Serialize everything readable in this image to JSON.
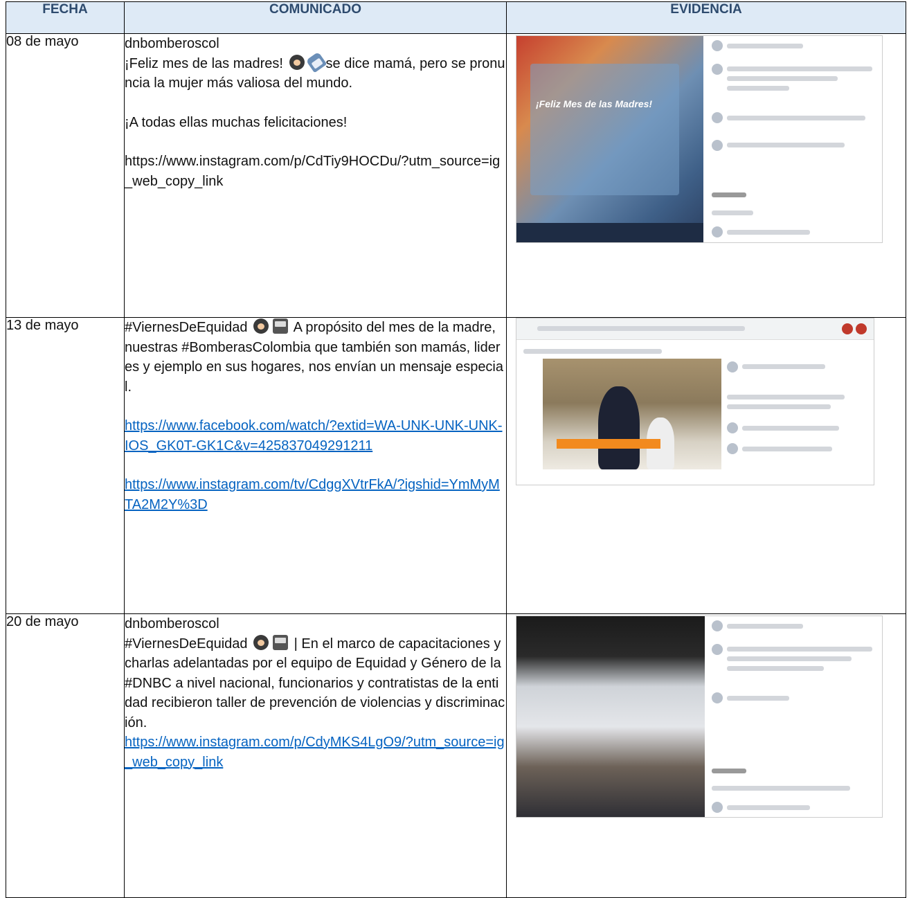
{
  "headers": {
    "fecha": "FECHA",
    "comunicado": "COMUNICADO",
    "evidencia": "EVIDENCIA"
  },
  "rows": [
    {
      "fecha": "08 de mayo",
      "account": "dnbomberoscol",
      "text_a": "¡Feliz mes de las madres!",
      "text_b": "se dice mamá, pero se pronuncia la mujer más valiosa del mundo.",
      "text_c": "¡A todas ellas muchas felicitaciones!",
      "link": "https://www.instagram.com/p/CdTiy9HOCDu/?utm_source=ig_web_copy_link",
      "emoji": [
        "woman-emoji",
        "baby-bottle-emoji"
      ],
      "evidence_banner": "¡Feliz Mes de las Madres!"
    },
    {
      "fecha": "13 de mayo",
      "text_a": "#ViernesDeEquidad",
      "text_b": "A propósito del mes de la madre, nuestras #BomberasColombia que también son mamás, lideres y ejemplo en sus hogares, nos envían un mensaje especial.",
      "link1": "https://www.facebook.com/watch/?extid=WA-UNK-UNK-UNK-IOS_GK0T-GK1C&v=425837049291211",
      "link2": "https://www.instagram.com/tv/CdggXVtrFkA/?igshid=YmMyMTA2M2Y%3D",
      "emoji": [
        "woman-emoji",
        "fire-engine-emoji"
      ]
    },
    {
      "fecha": "20 de mayo",
      "account": "dnbomberoscol",
      "text_a": "#ViernesDeEquidad",
      "text_b": "| En el marco de capacitaciones y charlas adelantadas por el equipo de Equidad y Género de la #DNBC a nivel nacional, funcionarios y contratistas de la entidad recibieron taller de prevención de violencias y discriminación.",
      "link": "https://www.instagram.com/p/CdyMKS4LgO9/?utm_source=ig_web_copy_link",
      "emoji": [
        "woman-emoji",
        "fire-engine-emoji"
      ]
    }
  ],
  "colors": {
    "header_bg": "#deeaf6",
    "header_text": "#2e4b6e",
    "link": "#0563c1"
  }
}
